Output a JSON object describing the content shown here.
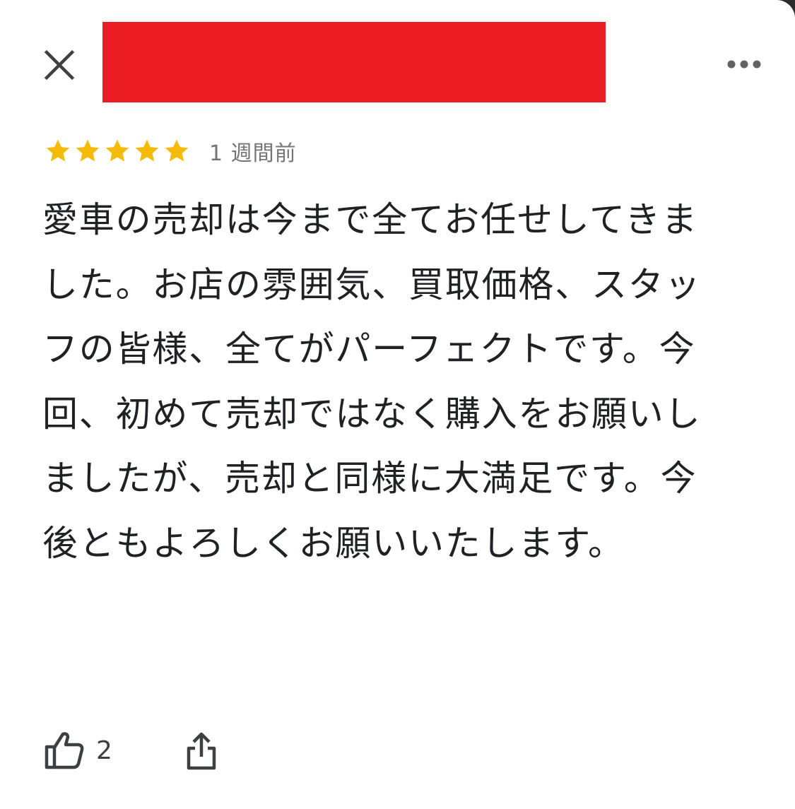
{
  "header": {
    "close_icon": "close-icon",
    "reviewer_name_redacted_color": "#ec1c24",
    "more_icon": "more-horizontal-icon"
  },
  "review": {
    "rating": 5,
    "max_rating": 5,
    "star_color": "#f6bb06",
    "time_ago": "1 週間前",
    "text": "愛車の売却は今まで全てお任せしてきました。お店の雰囲気、買取価格、スタッフの皆様、全てがパーフェクトです。今回、初めて売却ではなく購入をお願いしましたが、売却と同様に大満足です。今後ともよろしくお願いいたします。"
  },
  "actions": {
    "like_icon": "thumbs-up-icon",
    "like_count": "2",
    "share_icon": "share-icon"
  }
}
